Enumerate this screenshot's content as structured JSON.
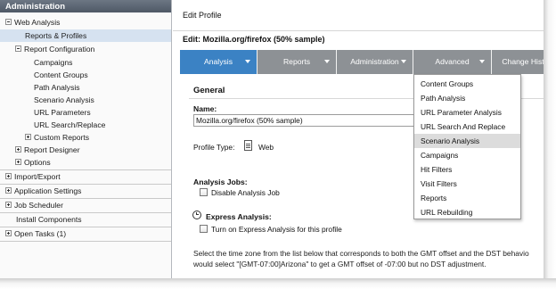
{
  "sidebar": {
    "header": "Administration",
    "items": [
      {
        "label": "Web Analysis",
        "toggle": "minus"
      },
      {
        "label": "Reports & Profiles",
        "toggle": "none",
        "selected": true
      },
      {
        "label": "Report Configuration",
        "toggle": "minus"
      },
      {
        "label": "Campaigns",
        "toggle": "none"
      },
      {
        "label": "Content Groups",
        "toggle": "none"
      },
      {
        "label": "Path Analysis",
        "toggle": "none"
      },
      {
        "label": "Scenario Analysis",
        "toggle": "none"
      },
      {
        "label": "URL Parameters",
        "toggle": "none"
      },
      {
        "label": "URL Search/Replace",
        "toggle": "none"
      },
      {
        "label": "Custom Reports",
        "toggle": "plus"
      },
      {
        "label": "Report Designer",
        "toggle": "plus"
      },
      {
        "label": "Options",
        "toggle": "plus"
      },
      {
        "label": "Import/Export",
        "toggle": "plus"
      },
      {
        "label": "Application Settings",
        "toggle": "plus"
      },
      {
        "label": "Job Scheduler",
        "toggle": "plus"
      },
      {
        "label": "Install Components",
        "toggle": "none"
      },
      {
        "label": "Open Tasks (1)",
        "toggle": "plus"
      }
    ]
  },
  "header": {
    "title": "Edit Profile",
    "subtitle": "Edit: Mozilla.org/firefox (50% sample)"
  },
  "nav": {
    "tabs": [
      {
        "label": "Analysis",
        "active": true
      },
      {
        "label": "Reports"
      },
      {
        "label": "Administration"
      },
      {
        "label": "Advanced"
      },
      {
        "label": "Change Hist"
      }
    ]
  },
  "dropdown": {
    "items": [
      "Content Groups",
      "Path Analysis",
      "URL Parameter Analysis",
      "URL Search And Replace",
      "Scenario Analysis",
      "Campaigns",
      "Hit Filters",
      "Visit Filters",
      "Reports",
      "URL Rebuilding"
    ],
    "hovered": "Scenario Analysis"
  },
  "form": {
    "section_title": "General",
    "name_label": "Name:",
    "name_value": "Mozilla.org/firefox (50% sample)",
    "profile_type_label": "Profile Type:",
    "profile_type_value": "Web",
    "analysis_jobs_label": "Analysis Jobs:",
    "disable_job_label": "Disable Analysis Job",
    "express_label": "Express Analysis:",
    "express_checkbox_label": "Turn on Express Analysis for this profile",
    "description_line1": "Select the time zone from the list below that corresponds to both the GMT offset and the DST behavio",
    "description_line2": "would select \"[GMT-07:00]Arizona\" to get a GMT offset of -07:00 but no DST adjustment."
  }
}
